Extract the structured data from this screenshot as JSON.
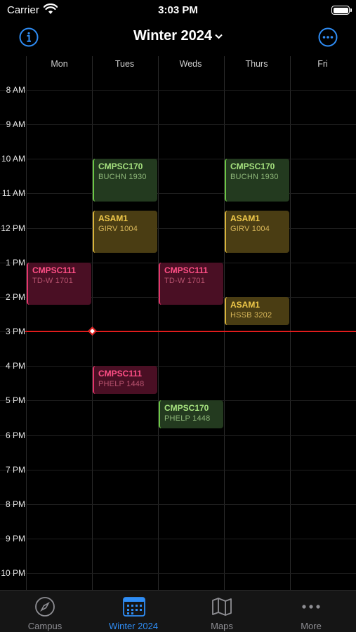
{
  "status_bar": {
    "carrier": "Carrier",
    "time": "3:03 PM",
    "battery_level": 1.0
  },
  "nav": {
    "title": "Winter 2024",
    "info_icon": "info-icon",
    "more_icon": "ellipsis-circle-icon"
  },
  "days": [
    "Mon",
    "Tues",
    "Weds",
    "Thurs",
    "Fri"
  ],
  "hours": [
    "8 AM",
    "9 AM",
    "10 AM",
    "11 AM",
    "12 PM",
    "1 PM",
    "2 PM",
    "3 PM",
    "4 PM",
    "5 PM",
    "6 PM",
    "7 PM",
    "8 PM",
    "9 PM",
    "10 PM"
  ],
  "current_time_hour": 15,
  "colors": {
    "green": "#6cc845",
    "yellow": "#d9b43a",
    "pink": "#e5336a",
    "now_line": "#e01c1c",
    "accent": "#2f8df5"
  },
  "events": [
    {
      "title": "CMPSC170",
      "location": "BUCHN 1930",
      "day": "Tues",
      "start": "10:00",
      "end": "11:15",
      "color": "green"
    },
    {
      "title": "CMPSC170",
      "location": "BUCHN 1930",
      "day": "Thurs",
      "start": "10:00",
      "end": "11:15",
      "color": "green"
    },
    {
      "title": "ASAM1",
      "location": "GIRV 1004",
      "day": "Tues",
      "start": "11:30",
      "end": "12:45",
      "color": "yellow"
    },
    {
      "title": "ASAM1",
      "location": "GIRV 1004",
      "day": "Thurs",
      "start": "11:30",
      "end": "12:45",
      "color": "yellow"
    },
    {
      "title": "CMPSC111",
      "location": "TD-W 1701",
      "day": "Mon",
      "start": "13:00",
      "end": "14:15",
      "color": "pink"
    },
    {
      "title": "CMPSC111",
      "location": "TD-W 1701",
      "day": "Weds",
      "start": "13:00",
      "end": "14:15",
      "color": "pink"
    },
    {
      "title": "ASAM1",
      "location": "HSSB 3202",
      "day": "Thurs",
      "start": "14:00",
      "end": "14:50",
      "color": "yellow"
    },
    {
      "title": "CMPSC111",
      "location": "PHELP 1448",
      "day": "Tues",
      "start": "16:00",
      "end": "16:50",
      "color": "pink"
    },
    {
      "title": "CMPSC170",
      "location": "PHELP 1448",
      "day": "Weds",
      "start": "17:00",
      "end": "17:50",
      "color": "green"
    }
  ],
  "tabs": [
    {
      "label": "Campus",
      "icon": "compass-icon",
      "active": false
    },
    {
      "label": "Winter 2024",
      "icon": "calendar-icon",
      "active": true
    },
    {
      "label": "Maps",
      "icon": "map-icon",
      "active": false
    },
    {
      "label": "More",
      "icon": "ellipsis-icon",
      "active": false
    }
  ]
}
